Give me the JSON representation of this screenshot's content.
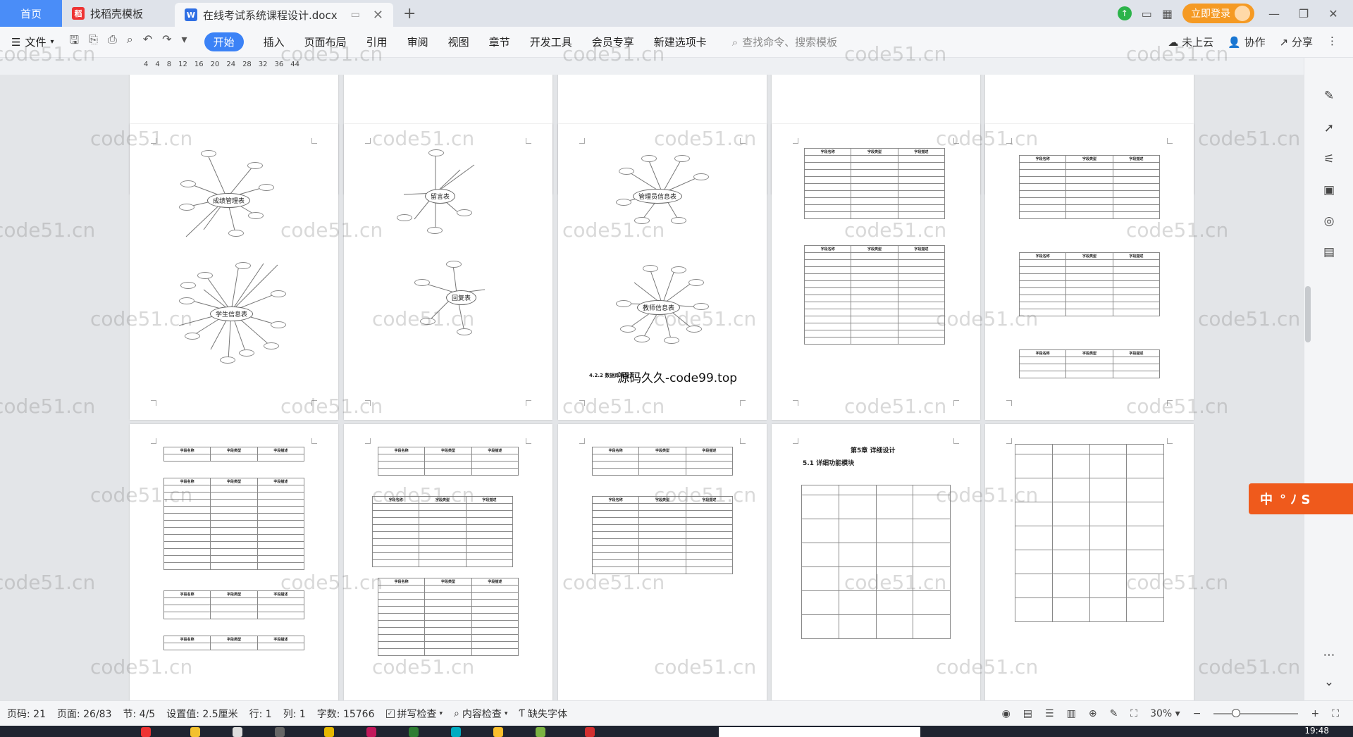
{
  "tabs": {
    "home": "首页",
    "template": "找稻壳模板",
    "document": "在线考试系统课程设计.docx"
  },
  "login": "立即登录",
  "menu": {
    "file": "文件",
    "items": [
      "开始",
      "插入",
      "页面布局",
      "引用",
      "审阅",
      "视图",
      "章节",
      "开发工具",
      "会员专享",
      "新建选项卡"
    ],
    "active": "开始",
    "search_placeholder": "查找命令、搜索模板",
    "cloud": "未上云",
    "collab": "协作",
    "share": "分享"
  },
  "ruler_numbers": [
    "4",
    "4",
    "8",
    "12",
    "16",
    "20",
    "24",
    "28",
    "32",
    "36",
    "44"
  ],
  "er_diagrams": {
    "grade": "成绩管理表",
    "student": "学生信息表",
    "message": "留言表",
    "reply": "回复表",
    "admin": "管理员信息表",
    "teacher": "教师信息表"
  },
  "doc_heading_422": "4.2.2 数据库表设计",
  "overlay_watermark": "源码久久-code99.top",
  "chapter5": "第5章 详细设计",
  "section51": "5.1 详细功能模块",
  "table_headers": [
    "字段名称",
    "字段类型",
    "字段描述"
  ],
  "watermark": "code51.cn",
  "status": {
    "page_code": "页码: 21",
    "page": "页面: 26/83",
    "section": "节: 4/5",
    "setting": "设置值: 2.5厘米",
    "row": "行: 1",
    "col": "列: 1",
    "words": "字数: 15766",
    "spell": "拼写检查",
    "content": "内容检查",
    "missing_font": "缺失字体",
    "zoom": "30%"
  },
  "clock": "19:48",
  "ime_label": "中",
  "colors": {
    "home_tab": "#4a8df8",
    "active_menu": "#3b82f6",
    "login": "#f59a23",
    "ime": "#ef5a1c"
  }
}
